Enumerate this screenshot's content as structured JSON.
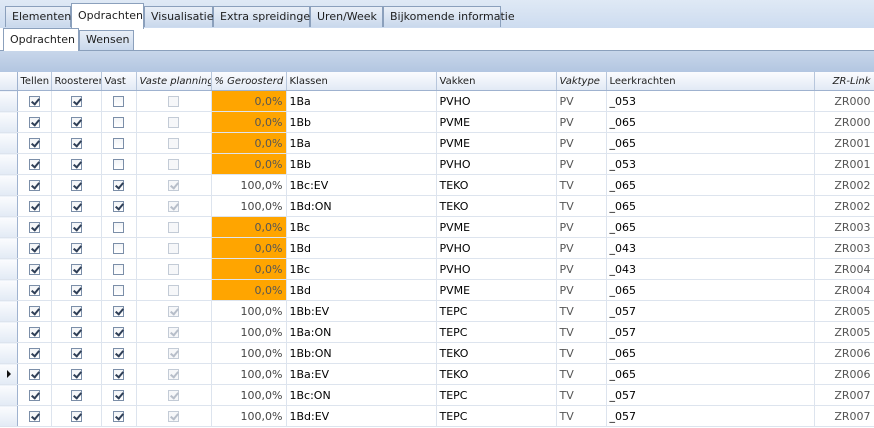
{
  "tabs": [
    {
      "label": "Elementen",
      "active": false
    },
    {
      "label": "Opdrachten",
      "active": true
    },
    {
      "label": "Visualisatie",
      "active": false
    },
    {
      "label": "Extra spreidingen",
      "active": false
    },
    {
      "label": "Uren/Week",
      "active": false
    },
    {
      "label": "Bijkomende informatie",
      "active": false
    }
  ],
  "subtabs": [
    {
      "label": "Opdrachten",
      "active": true
    },
    {
      "label": "Wensen",
      "active": false
    }
  ],
  "columns": [
    "Tellen",
    "Roosteren",
    "Vast",
    "Vaste planning",
    "% Geroosterd",
    "Klassen",
    "Vakken",
    "Vaktype",
    "Leerkrachten",
    "ZR-Link"
  ],
  "colors": {
    "highlight": "#ffa500"
  },
  "rows": [
    {
      "tellen": true,
      "roosteren": true,
      "vast": false,
      "vaste_planning": false,
      "geroosterd": "0,0%",
      "klassen": "1Ba",
      "vakken": "PVHO",
      "vaktype": "PV",
      "leerkrachten": "_053",
      "zr_link": "ZR000",
      "current": false
    },
    {
      "tellen": true,
      "roosteren": true,
      "vast": false,
      "vaste_planning": false,
      "geroosterd": "0,0%",
      "klassen": "1Bb",
      "vakken": "PVME",
      "vaktype": "PV",
      "leerkrachten": "_065",
      "zr_link": "ZR000",
      "current": false
    },
    {
      "tellen": true,
      "roosteren": true,
      "vast": false,
      "vaste_planning": false,
      "geroosterd": "0,0%",
      "klassen": "1Ba",
      "vakken": "PVME",
      "vaktype": "PV",
      "leerkrachten": "_065",
      "zr_link": "ZR001",
      "current": false
    },
    {
      "tellen": true,
      "roosteren": true,
      "vast": false,
      "vaste_planning": false,
      "geroosterd": "0,0%",
      "klassen": "1Bb",
      "vakken": "PVHO",
      "vaktype": "PV",
      "leerkrachten": "_053",
      "zr_link": "ZR001",
      "current": false
    },
    {
      "tellen": true,
      "roosteren": true,
      "vast": true,
      "vaste_planning": true,
      "geroosterd": "100,0%",
      "klassen": "1Bc:EV",
      "vakken": "TEKO",
      "vaktype": "TV",
      "leerkrachten": "_065",
      "zr_link": "ZR002",
      "current": false
    },
    {
      "tellen": true,
      "roosteren": true,
      "vast": true,
      "vaste_planning": true,
      "geroosterd": "100,0%",
      "klassen": "1Bd:ON",
      "vakken": "TEKO",
      "vaktype": "TV",
      "leerkrachten": "_065",
      "zr_link": "ZR002",
      "current": false
    },
    {
      "tellen": true,
      "roosteren": true,
      "vast": false,
      "vaste_planning": false,
      "geroosterd": "0,0%",
      "klassen": "1Bc",
      "vakken": "PVME",
      "vaktype": "PV",
      "leerkrachten": "_065",
      "zr_link": "ZR003",
      "current": false
    },
    {
      "tellen": true,
      "roosteren": true,
      "vast": false,
      "vaste_planning": false,
      "geroosterd": "0,0%",
      "klassen": "1Bd",
      "vakken": "PVHO",
      "vaktype": "PV",
      "leerkrachten": "_043",
      "zr_link": "ZR003",
      "current": false
    },
    {
      "tellen": true,
      "roosteren": true,
      "vast": false,
      "vaste_planning": false,
      "geroosterd": "0,0%",
      "klassen": "1Bc",
      "vakken": "PVHO",
      "vaktype": "PV",
      "leerkrachten": "_043",
      "zr_link": "ZR004",
      "current": false
    },
    {
      "tellen": true,
      "roosteren": true,
      "vast": false,
      "vaste_planning": false,
      "geroosterd": "0,0%",
      "klassen": "1Bd",
      "vakken": "PVME",
      "vaktype": "PV",
      "leerkrachten": "_065",
      "zr_link": "ZR004",
      "current": false
    },
    {
      "tellen": true,
      "roosteren": true,
      "vast": true,
      "vaste_planning": true,
      "geroosterd": "100,0%",
      "klassen": "1Bb:EV",
      "vakken": "TEPC",
      "vaktype": "TV",
      "leerkrachten": "_057",
      "zr_link": "ZR005",
      "current": false
    },
    {
      "tellen": true,
      "roosteren": true,
      "vast": true,
      "vaste_planning": true,
      "geroosterd": "100,0%",
      "klassen": "1Ba:ON",
      "vakken": "TEPC",
      "vaktype": "TV",
      "leerkrachten": "_057",
      "zr_link": "ZR005",
      "current": false
    },
    {
      "tellen": true,
      "roosteren": true,
      "vast": true,
      "vaste_planning": true,
      "geroosterd": "100,0%",
      "klassen": "1Bb:ON",
      "vakken": "TEKO",
      "vaktype": "TV",
      "leerkrachten": "_065",
      "zr_link": "ZR006",
      "current": false
    },
    {
      "tellen": true,
      "roosteren": true,
      "vast": true,
      "vaste_planning": true,
      "geroosterd": "100,0%",
      "klassen": "1Ba:EV",
      "vakken": "TEKO",
      "vaktype": "TV",
      "leerkrachten": "_065",
      "zr_link": "ZR006",
      "current": true
    },
    {
      "tellen": true,
      "roosteren": true,
      "vast": true,
      "vaste_planning": true,
      "geroosterd": "100,0%",
      "klassen": "1Bc:ON",
      "vakken": "TEPC",
      "vaktype": "TV",
      "leerkrachten": "_057",
      "zr_link": "ZR007",
      "current": false
    },
    {
      "tellen": true,
      "roosteren": true,
      "vast": true,
      "vaste_planning": true,
      "geroosterd": "100,0%",
      "klassen": "1Bd:EV",
      "vakken": "TEPC",
      "vaktype": "TV",
      "leerkrachten": "_057",
      "zr_link": "ZR007",
      "current": false
    }
  ]
}
